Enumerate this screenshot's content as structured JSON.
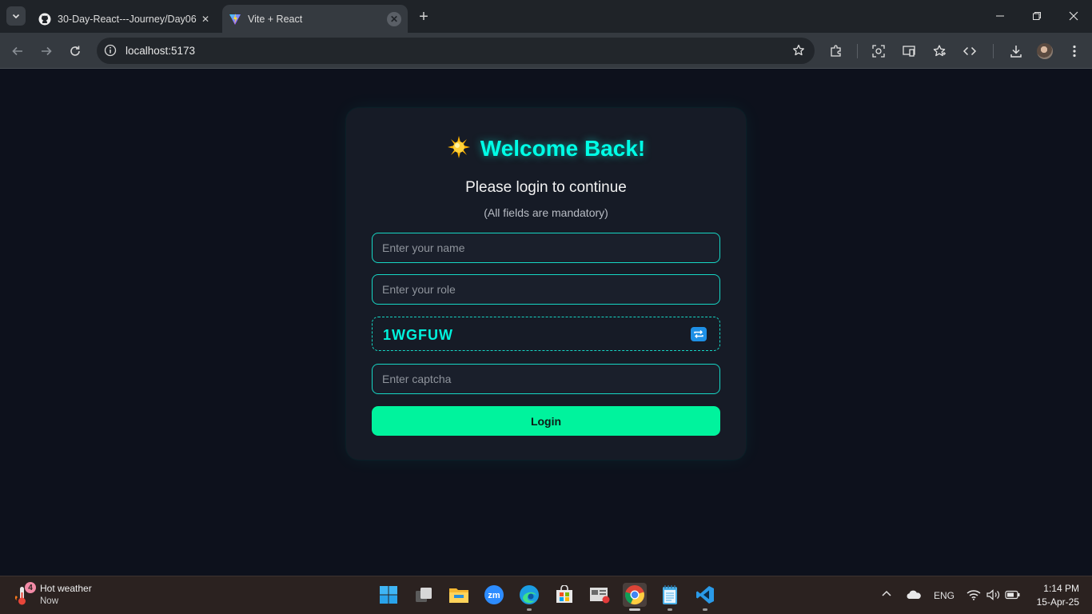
{
  "browser": {
    "tabs": [
      {
        "title": "30-Day-React---Journey/Day06",
        "icon": "github-icon"
      },
      {
        "title": "Vite + React",
        "icon": "vite-icon",
        "active": true
      }
    ],
    "address": "localhost:5173"
  },
  "page": {
    "heading_emoji": "🌟",
    "heading": "Welcome Back!",
    "subtitle": "Please login to continue",
    "note": "(All fields are mandatory)",
    "name_placeholder": "Enter your name",
    "role_placeholder": "Enter your role",
    "captcha_code": "1WGFUW",
    "captcha_placeholder": "Enter captcha",
    "login_label": "Login"
  },
  "taskbar": {
    "weather_badge": "4",
    "weather_title": "Hot weather",
    "weather_sub": "Now",
    "language": "ENG",
    "time": "1:14 PM",
    "date": "15-Apr-25"
  },
  "colors": {
    "accent": "#00ffe6",
    "button": "#00f39d",
    "page_bg": "#0d111c",
    "card_bg": "#161b26"
  }
}
